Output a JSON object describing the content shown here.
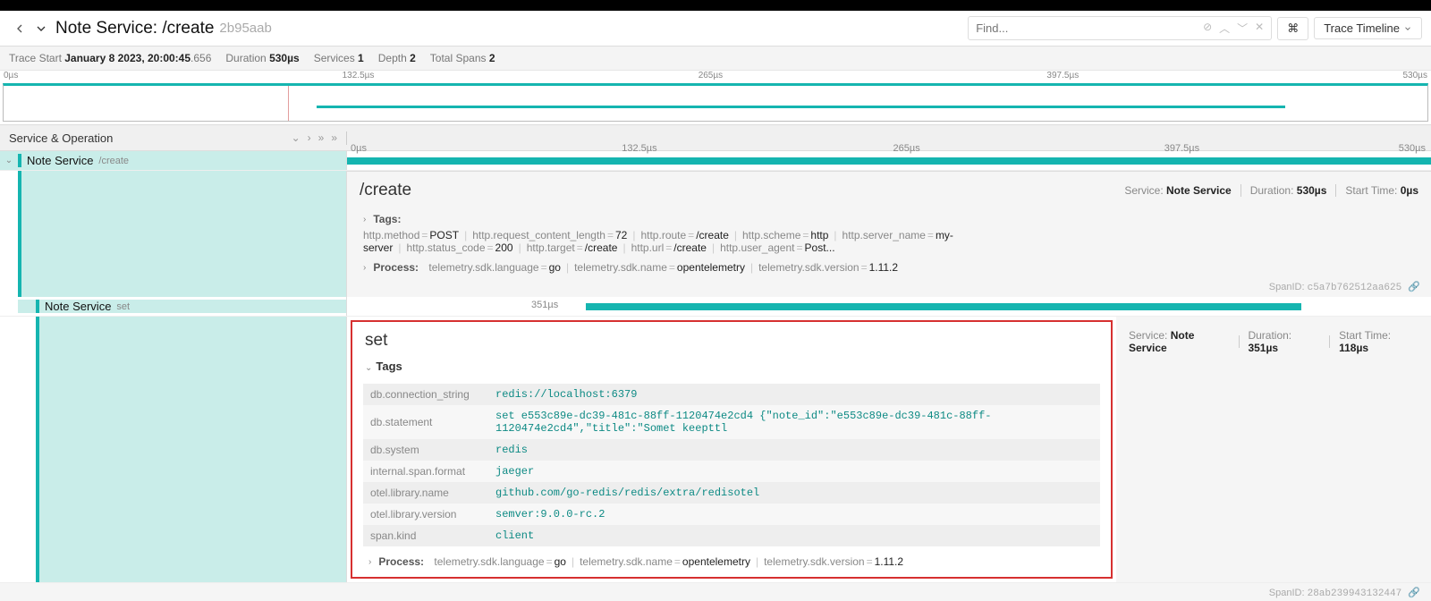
{
  "header": {
    "service_label": "Note Service:",
    "operation": "/create",
    "trace_id_short": "2b95aab",
    "find_placeholder": "Find...",
    "kbd_label": "⌘",
    "timeline_btn": "Trace Timeline"
  },
  "summary": {
    "trace_start_label": "Trace Start",
    "trace_start_val": "January 8 2023, 20:00:45",
    "trace_start_ms": ".656",
    "duration_label": "Duration",
    "duration_val": "530µs",
    "services_label": "Services",
    "services_val": "1",
    "depth_label": "Depth",
    "depth_val": "2",
    "total_spans_label": "Total Spans",
    "total_spans_val": "2"
  },
  "minimap_ticks": [
    "0µs",
    "132.5µs",
    "265µs",
    "397.5µs",
    "530µs"
  ],
  "left_header": "Service & Operation",
  "timeline_ticks": [
    "0µs",
    "132.5µs",
    "265µs",
    "397.5µs"
  ],
  "timeline_end": "530µs",
  "spans": [
    {
      "service": "Note Service",
      "operation": "/create",
      "span_id": "c5a7b762512aa625",
      "detail": {
        "title": "/create",
        "service_label": "Service:",
        "service_val": "Note Service",
        "duration_label": "Duration:",
        "duration_val": "530µs",
        "start_label": "Start Time:",
        "start_val": "0µs",
        "tags_label": "Tags:",
        "tags": [
          {
            "k": "http.method",
            "v": "POST"
          },
          {
            "k": "http.request_content_length",
            "v": "72"
          },
          {
            "k": "http.route",
            "v": "/create"
          },
          {
            "k": "http.scheme",
            "v": "http"
          },
          {
            "k": "http.server_name",
            "v": "my-server"
          },
          {
            "k": "http.status_code",
            "v": "200"
          },
          {
            "k": "http.target",
            "v": "/create"
          },
          {
            "k": "http.url",
            "v": "/create"
          },
          {
            "k": "http.user_agent",
            "v": "Post..."
          }
        ],
        "process_label": "Process:",
        "process": [
          {
            "k": "telemetry.sdk.language",
            "v": "go"
          },
          {
            "k": "telemetry.sdk.name",
            "v": "opentelemetry"
          },
          {
            "k": "telemetry.sdk.version",
            "v": "1.11.2"
          }
        ],
        "spanid_label": "SpanID:"
      }
    },
    {
      "service": "Note Service",
      "operation": "set",
      "bar_label": "351µs",
      "span_id": "28ab239943132447",
      "detail": {
        "title": "set",
        "service_label": "Service:",
        "service_val": "Note Service",
        "duration_label": "Duration:",
        "duration_val": "351µs",
        "start_label": "Start Time:",
        "start_val": "118µs",
        "tags_label": "Tags",
        "tags_table": [
          {
            "k": "db.connection_string",
            "v": "redis://localhost:6379"
          },
          {
            "k": "db.statement",
            "v": "set e553c89e-dc39-481c-88ff-1120474e2cd4 {\"note_id\":\"e553c89e-dc39-481c-88ff-1120474e2cd4\",\"title\":\"Somet keepttl"
          },
          {
            "k": "db.system",
            "v": "redis"
          },
          {
            "k": "internal.span.format",
            "v": "jaeger"
          },
          {
            "k": "otel.library.name",
            "v": "github.com/go-redis/redis/extra/redisotel"
          },
          {
            "k": "otel.library.version",
            "v": "semver:9.0.0-rc.2"
          },
          {
            "k": "span.kind",
            "v": "client"
          }
        ],
        "process_label": "Process:",
        "process": [
          {
            "k": "telemetry.sdk.language",
            "v": "go"
          },
          {
            "k": "telemetry.sdk.name",
            "v": "opentelemetry"
          },
          {
            "k": "telemetry.sdk.version",
            "v": "1.11.2"
          }
        ],
        "spanid_label": "SpanID:"
      }
    }
  ]
}
